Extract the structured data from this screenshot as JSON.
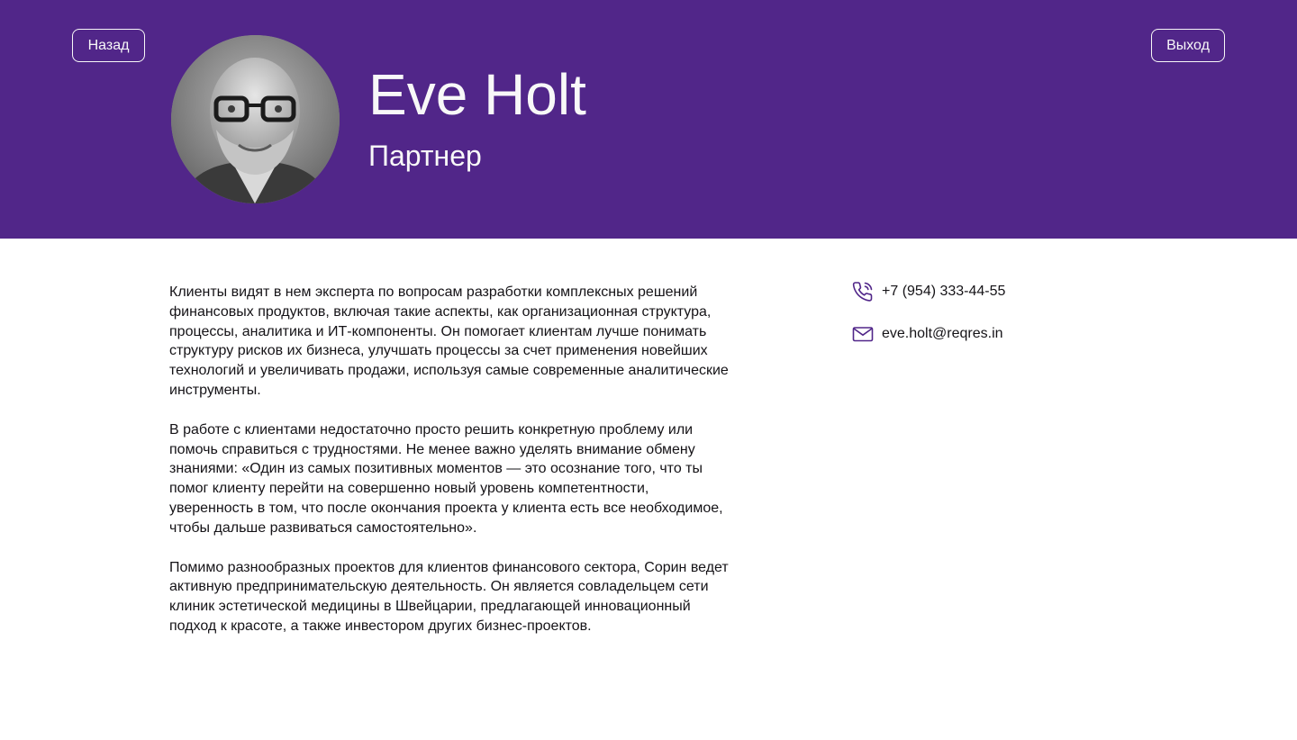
{
  "colors": {
    "header_bg": "#512689",
    "header_text": "#f8f8f8",
    "body_text": "#151317",
    "icon": "#512689"
  },
  "header": {
    "back_label": "Назад",
    "exit_label": "Выход",
    "name": "Eve Holt",
    "role": "Партнер",
    "avatar_icon": "avatar-photo"
  },
  "about": {
    "paragraphs": [
      "Клиенты видят в нем эксперта по вопросам разработки комплексных решений финансовых продуктов, включая такие аспекты, как организационная структура, процессы, аналитика и ИТ-компоненты. Он помогает клиентам лучше понимать структуру рисков их бизнеса, улучшать процессы за счет применения новейших технологий и увеличивать продажи, используя самые современные аналитические инструменты.",
      "В работе с клиентами недостаточно просто решить конкретную проблему или помочь справиться с трудностями. Не менее важно уделять внимание обмену знаниями: «Один из самых позитивных моментов — это осознание того, что ты помог клиенту перейти на совершенно новый уровень компетентности, уверенность в том, что после окончания проекта у клиента есть все необходимое, чтобы дальше развиваться самостоятельно».",
      "Помимо разнообразных проектов для клиентов финансового сектора, Сорин ведет активную предпринимательскую деятельность. Он является совладельцем сети клиник эстетической медицины в Швейцарии, предлагающей инновационный подход к красоте, а также инвестором других бизнес-проектов."
    ]
  },
  "contacts": {
    "phone": "+7 (954) 333-44-55",
    "phone_icon": "phone-icon",
    "email": "eve.holt@reqres.in",
    "email_icon": "mail-icon"
  }
}
